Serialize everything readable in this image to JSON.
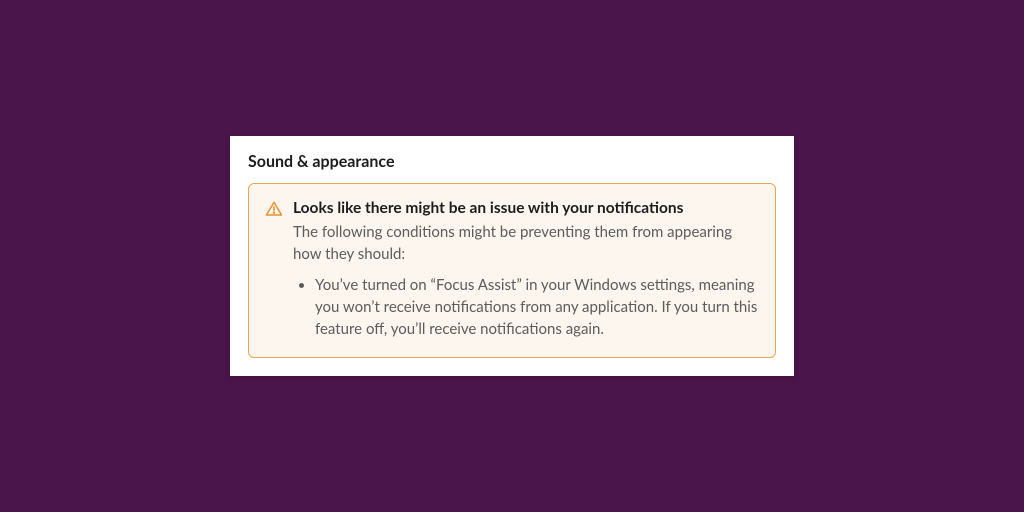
{
  "section": {
    "title": "Sound & appearance"
  },
  "alert": {
    "icon_name": "warning-triangle-icon",
    "title": "Looks like there might be an issue with your notifications",
    "subtext": "The following conditions might be preventing them from appearing how they should:",
    "bullets": [
      "You’ve turned on “Focus Assist” in your Windows settings, meaning you won’t receive notifications from any application. If you turn this feature off, you’ll receive notifications again."
    ]
  },
  "colors": {
    "background": "#4a154b",
    "panel_bg": "#ffffff",
    "alert_bg": "#fdf6ee",
    "alert_border": "#e8a94f",
    "icon_stroke": "#e8912d",
    "text_primary": "#1d1c1d",
    "text_secondary": "#5c5c5c"
  }
}
